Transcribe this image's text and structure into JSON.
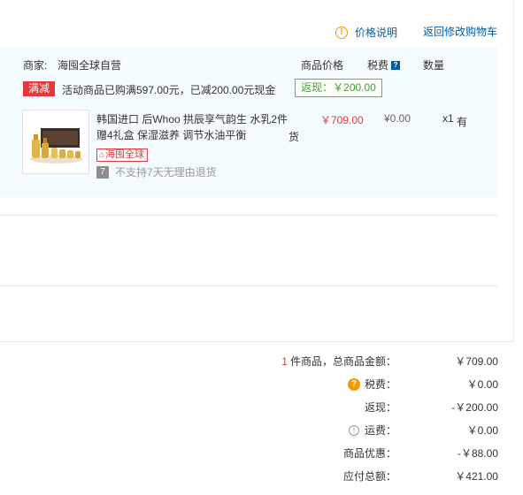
{
  "header": {
    "price_note": "价格说明",
    "back_link": "返回修改购物车"
  },
  "order": {
    "merchant_label": "商家:",
    "merchant_name": "海囤全球自营",
    "columns": {
      "price": "商品价格",
      "tax": "税费",
      "qty": "数量"
    },
    "promo": {
      "tag": "满减",
      "text": "活动商品已购满597.00元，已减200.00元现金",
      "rebate": "返现：￥200.00"
    },
    "item": {
      "title": "韩国进口 后Whoo 拱辰享气韵生 水乳2件赠4礼盒 保湿滋养 调节水油平衡",
      "title_tail": "货",
      "tag": "海囤全球",
      "return_icon": "7",
      "return_text": "不支持7天无理由退货",
      "price": "￥709.00",
      "tax": "¥0.00",
      "qty": "x1",
      "stock": "有"
    }
  },
  "summary": {
    "count": "1",
    "total_label": "件商品，总商品金额：",
    "total_value": "￥709.00",
    "tax_label": "税费：",
    "tax_value": "￥0.00",
    "rebate_label": "返现：",
    "rebate_value": "-￥200.00",
    "shipping_label": "运费：",
    "shipping_value": "￥0.00",
    "discount_label": "商品优惠：",
    "discount_value": "-￥88.00",
    "payable_label": "应付总额：",
    "payable_value": "￥421.00"
  },
  "icons": {
    "price_note": "warning-circle-icon",
    "tax_help": "question-square-icon",
    "summary_tax": "question-circle-icon",
    "shipping": "info-circle-icon",
    "tag_globe": "globe-icon"
  },
  "colors": {
    "link": "#005ea7",
    "accent_red": "#e4393c",
    "rebate_green": "#4a9b3e",
    "warning_orange": "#f39800",
    "panel_bg": "#f3fbfe"
  }
}
